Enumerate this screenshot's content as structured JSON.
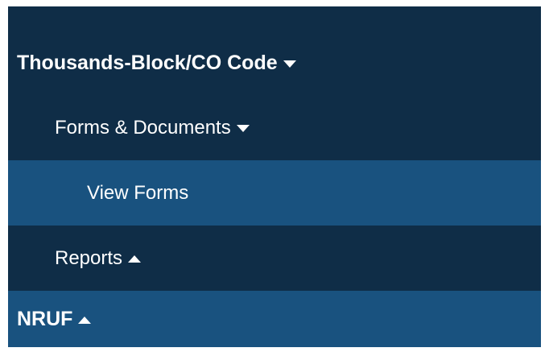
{
  "menu": {
    "items": [
      {
        "label": "Thousands-Block/CO Code",
        "caret": "chevron-down-icon"
      },
      {
        "label": "Forms & Documents",
        "caret": "chevron-down-icon"
      },
      {
        "label": "View Forms"
      },
      {
        "label": "Reports",
        "caret": "chevron-up-icon"
      },
      {
        "label": "NRUF",
        "caret": "chevron-up-icon"
      }
    ]
  },
  "colors": {
    "background": "#0f2d47",
    "highlight": "#19527f",
    "text": "#ffffff"
  }
}
